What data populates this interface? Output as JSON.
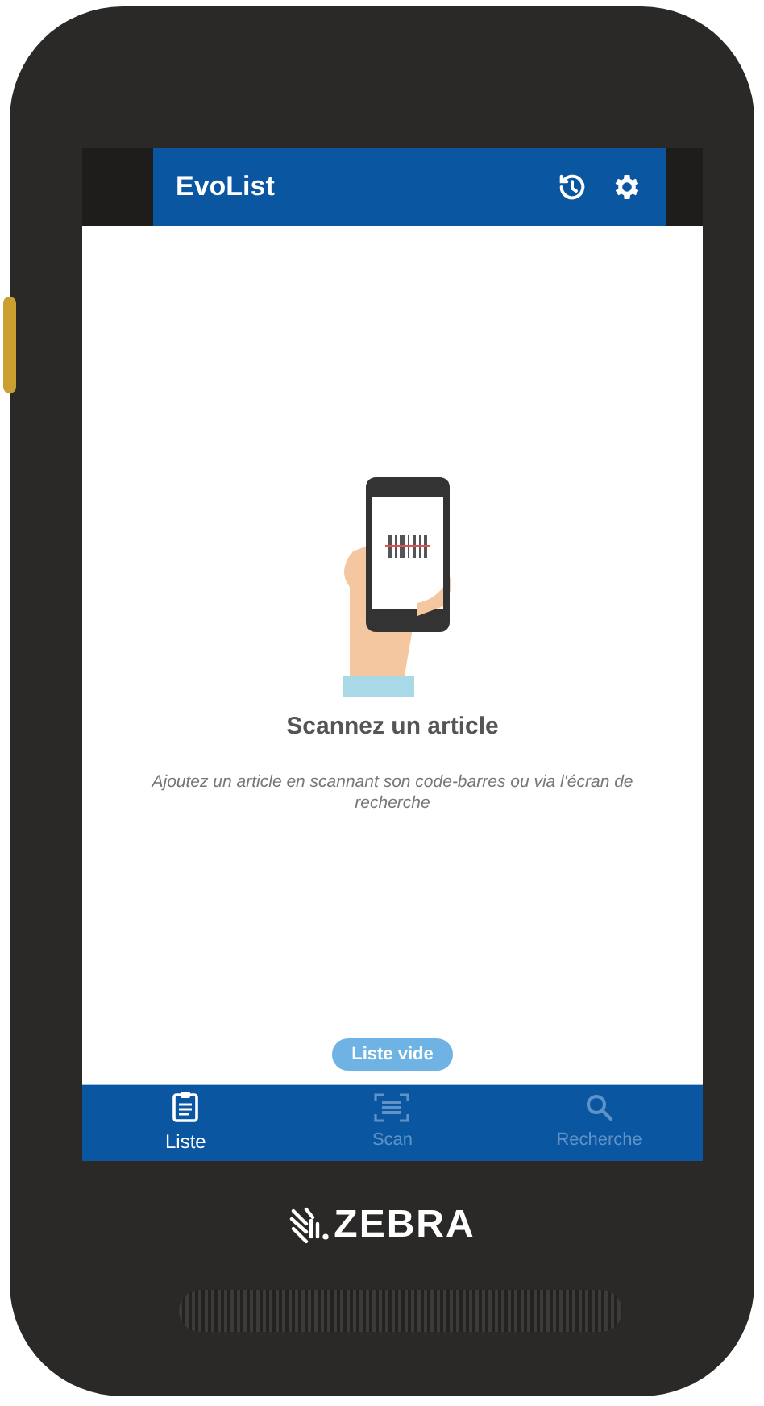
{
  "app_bar": {
    "title": "EvoList"
  },
  "empty_state": {
    "title": "Scannez un article",
    "description": "Ajoutez un article en scannant son code-barres ou via l'écran de recherche"
  },
  "status_badge": "Liste vide",
  "bottom_nav": [
    {
      "kind": "list",
      "label": "Liste",
      "selected": true
    },
    {
      "kind": "scan",
      "label": "Scan",
      "selected": false
    },
    {
      "kind": "search",
      "label": "Recherche",
      "selected": false
    }
  ],
  "device": {
    "brand": "ZEBRA"
  }
}
